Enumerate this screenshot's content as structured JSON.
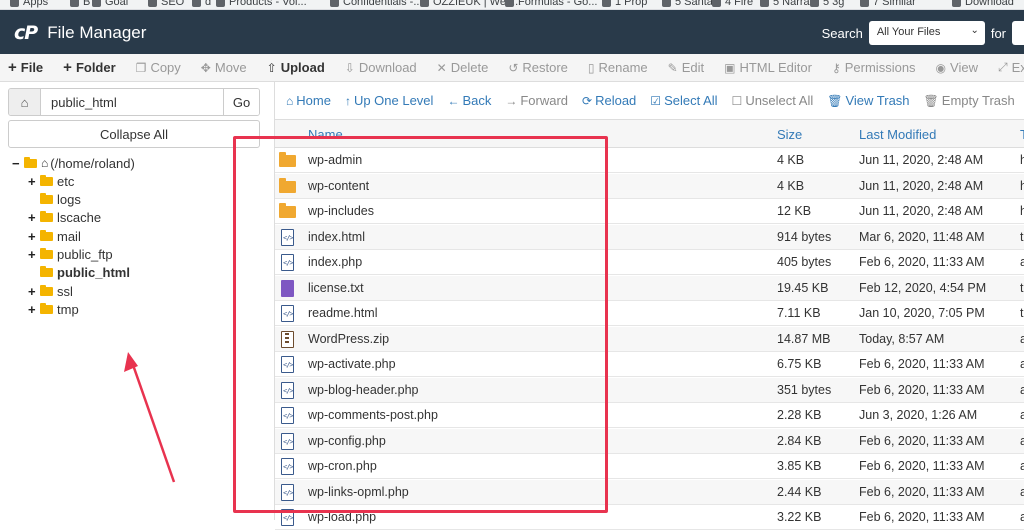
{
  "bookmarks": [
    "Apps",
    "B",
    "Goal",
    "SEO",
    "d",
    "Products - Vol...",
    "Confidentials -...",
    "OZZIEUK | Web...",
    "Formulas - Go...",
    "1 Prop",
    "5 Santa",
    "4 Fire",
    "5 Narrah",
    "5 3g",
    "7 Similar",
    "Download"
  ],
  "header": {
    "logo": "cP",
    "title": "File Manager",
    "search_label": "Search",
    "search_scope": "All Your Files",
    "for_label": "for"
  },
  "toolbar": [
    {
      "label": "File",
      "icon": "+",
      "enabled": true,
      "name": "new-file-button"
    },
    {
      "label": "Folder",
      "icon": "+",
      "enabled": true,
      "name": "new-folder-button"
    },
    {
      "label": "Copy",
      "icon": "❐",
      "enabled": false,
      "name": "copy-button"
    },
    {
      "label": "Move",
      "icon": "✥",
      "enabled": false,
      "name": "move-button"
    },
    {
      "label": "Upload",
      "icon": "⇧",
      "enabled": true,
      "name": "upload-button"
    },
    {
      "label": "Download",
      "icon": "⇩",
      "enabled": false,
      "name": "download-button"
    },
    {
      "label": "Delete",
      "icon": "✕",
      "enabled": false,
      "name": "delete-button"
    },
    {
      "label": "Restore",
      "icon": "↺",
      "enabled": false,
      "name": "restore-button"
    },
    {
      "label": "Rename",
      "icon": "▯",
      "enabled": false,
      "name": "rename-button"
    },
    {
      "label": "Edit",
      "icon": "✎",
      "enabled": false,
      "name": "edit-button"
    },
    {
      "label": "HTML Editor",
      "icon": "▣",
      "enabled": false,
      "name": "html-editor-button"
    },
    {
      "label": "Permissions",
      "icon": "⚷",
      "enabled": false,
      "name": "permissions-button"
    },
    {
      "label": "View",
      "icon": "◉",
      "enabled": false,
      "name": "view-button"
    },
    {
      "label": "Extract",
      "icon": "⤢",
      "enabled": false,
      "name": "extract-button"
    }
  ],
  "sidebar": {
    "path_value": "public_html",
    "go_label": "Go",
    "collapse_label": "Collapse All",
    "tree": [
      {
        "label": "(/home/roland)",
        "toggle": "−",
        "depth": 0,
        "home": true,
        "bold": false
      },
      {
        "label": "etc",
        "toggle": "+",
        "depth": 1,
        "bold": false
      },
      {
        "label": "logs",
        "toggle": "",
        "depth": 1,
        "bold": false
      },
      {
        "label": "lscache",
        "toggle": "+",
        "depth": 1,
        "bold": false
      },
      {
        "label": "mail",
        "toggle": "+",
        "depth": 1,
        "bold": false
      },
      {
        "label": "public_ftp",
        "toggle": "+",
        "depth": 1,
        "bold": false
      },
      {
        "label": "public_html",
        "toggle": "",
        "depth": 1,
        "bold": true
      },
      {
        "label": "ssl",
        "toggle": "+",
        "depth": 1,
        "bold": false
      },
      {
        "label": "tmp",
        "toggle": "+",
        "depth": 1,
        "bold": false
      }
    ]
  },
  "nav": [
    {
      "label": "Home",
      "icon": "⌂",
      "style": "blue",
      "name": "home-nav-button"
    },
    {
      "label": "Up One Level",
      "icon": "↑",
      "style": "blue",
      "name": "up-one-level-button"
    },
    {
      "label": "Back",
      "icon": "←",
      "style": "blue",
      "name": "back-button"
    },
    {
      "label": "Forward",
      "icon": "→",
      "style": "grey",
      "name": "forward-button"
    },
    {
      "label": "Reload",
      "icon": "⟳",
      "style": "blue",
      "name": "reload-button"
    },
    {
      "label": "Select All",
      "icon": "☑",
      "style": "blue",
      "name": "select-all-button"
    },
    {
      "label": "Unselect All",
      "icon": "☐",
      "style": "grey",
      "name": "unselect-all-button"
    },
    {
      "label": "View Trash",
      "icon": "🗑",
      "style": "blue",
      "name": "view-trash-button"
    },
    {
      "label": "Empty Trash",
      "icon": "🗑",
      "style": "grey",
      "name": "empty-trash-button"
    }
  ],
  "table": {
    "columns": {
      "name": "Name",
      "size": "Size",
      "modified": "Last Modified",
      "type": "T"
    },
    "rows": [
      {
        "name": "wp-admin",
        "size": "4 KB",
        "modified": "Jun 11, 2020, 2:48 AM",
        "type": "folder",
        "col4": "h"
      },
      {
        "name": "wp-content",
        "size": "4 KB",
        "modified": "Jun 11, 2020, 2:48 AM",
        "type": "folder",
        "col4": "h"
      },
      {
        "name": "wp-includes",
        "size": "12 KB",
        "modified": "Jun 11, 2020, 2:48 AM",
        "type": "folder",
        "col4": "h"
      },
      {
        "name": "index.html",
        "size": "914 bytes",
        "modified": "Mar 6, 2020, 11:48 AM",
        "type": "doc",
        "col4": "t"
      },
      {
        "name": "index.php",
        "size": "405 bytes",
        "modified": "Feb 6, 2020, 11:33 AM",
        "type": "doc",
        "col4": "a"
      },
      {
        "name": "license.txt",
        "size": "19.45 KB",
        "modified": "Feb 12, 2020, 4:54 PM",
        "type": "txt",
        "col4": "t"
      },
      {
        "name": "readme.html",
        "size": "7.11 KB",
        "modified": "Jan 10, 2020, 7:05 PM",
        "type": "doc",
        "col4": "t"
      },
      {
        "name": "WordPress.zip",
        "size": "14.87 MB",
        "modified": "Today, 8:57 AM",
        "type": "zip",
        "col4": "a"
      },
      {
        "name": "wp-activate.php",
        "size": "6.75 KB",
        "modified": "Feb 6, 2020, 11:33 AM",
        "type": "doc",
        "col4": "a"
      },
      {
        "name": "wp-blog-header.php",
        "size": "351 bytes",
        "modified": "Feb 6, 2020, 11:33 AM",
        "type": "doc",
        "col4": "a"
      },
      {
        "name": "wp-comments-post.php",
        "size": "2.28 KB",
        "modified": "Jun 3, 2020, 1:26 AM",
        "type": "doc",
        "col4": "a"
      },
      {
        "name": "wp-config.php",
        "size": "2.84 KB",
        "modified": "Feb 6, 2020, 11:33 AM",
        "type": "doc",
        "col4": "a"
      },
      {
        "name": "wp-cron.php",
        "size": "3.85 KB",
        "modified": "Feb 6, 2020, 11:33 AM",
        "type": "doc",
        "col4": "a"
      },
      {
        "name": "wp-links-opml.php",
        "size": "2.44 KB",
        "modified": "Feb 6, 2020, 11:33 AM",
        "type": "doc",
        "col4": "a"
      },
      {
        "name": "wp-load.php",
        "size": "3.22 KB",
        "modified": "Feb 6, 2020, 11:33 AM",
        "type": "doc",
        "col4": "a"
      }
    ]
  },
  "colors": {
    "topbar": "#293a4a",
    "link": "#337ab7",
    "highlight": "#e8334f",
    "folder": "#f0a830"
  }
}
